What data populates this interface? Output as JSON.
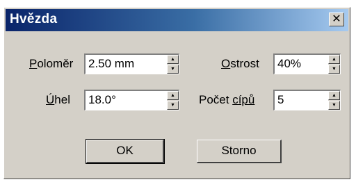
{
  "window": {
    "title": "Hvězda",
    "close_glyph": "✕"
  },
  "fields": {
    "radius": {
      "label_mnemonic": "P",
      "label_rest": "oloměr",
      "value": "2.50 mm"
    },
    "sharpness": {
      "label_mnemonic": "O",
      "label_rest": "strost",
      "value": "40%"
    },
    "angle": {
      "label_mnemonic": "Ú",
      "label_rest": "hel",
      "value": "18.0°"
    },
    "points": {
      "label_prefix": "Počet ",
      "label_mnemonic": "cípů",
      "value": "5"
    }
  },
  "buttons": {
    "ok": "OK",
    "cancel": "Storno"
  },
  "icons": {
    "close": "close-icon",
    "spin_up": "spin-up-arrow-icon",
    "spin_down": "spin-down-arrow-icon"
  },
  "colors": {
    "titlebar_start": "#0a246a",
    "titlebar_end": "#a6caf0",
    "dialog_face": "#d4d0c8"
  }
}
